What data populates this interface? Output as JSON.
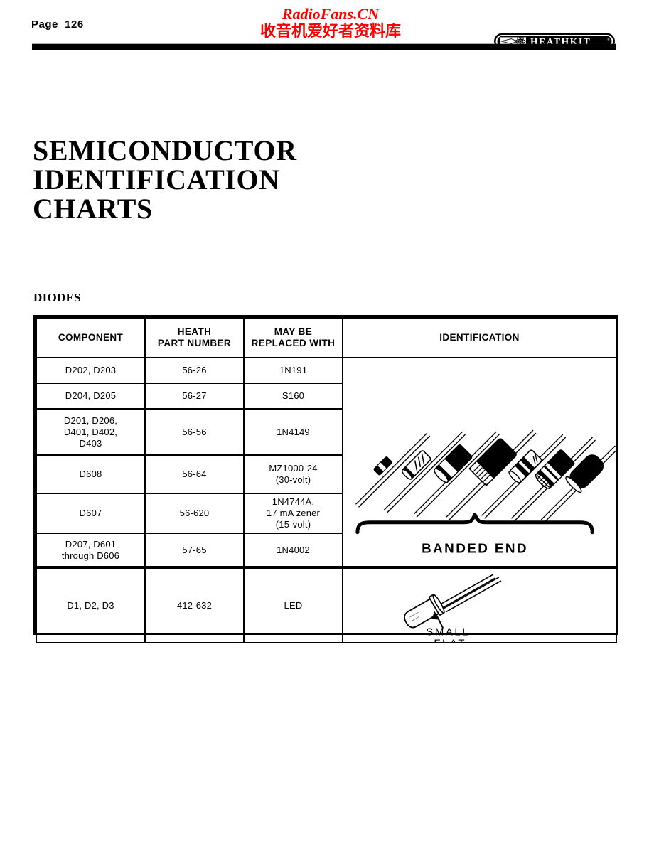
{
  "page": {
    "page_label": "Page  126",
    "brand_logo_text": "HEATHKIT",
    "watermark_latin": "RadioFans.CN",
    "watermark_cjk": "收音机爱好者资料库"
  },
  "title": {
    "line1": "SEMICONDUCTOR",
    "line2": "IDENTIFICATION",
    "line3": "CHARTS"
  },
  "section": {
    "label": "DIODES"
  },
  "table": {
    "headers": {
      "component": "COMPONENT",
      "part_number": "HEATH\nPART NUMBER",
      "replacement": "MAY BE\nREPLACED WITH",
      "identification": "IDENTIFICATION"
    },
    "rows": [
      {
        "component": "D202, D203",
        "part_number": "56-26",
        "replacement": "1N191"
      },
      {
        "component": "D204, D205",
        "part_number": "56-27",
        "replacement": "S160"
      },
      {
        "component": "D201, D206,\nD401, D402,\nD403",
        "part_number": "56-56",
        "replacement": "1N4149"
      },
      {
        "component": "D608",
        "part_number": "56-64",
        "replacement": "MZ1000-24\n(30-volt)"
      },
      {
        "component": "D607",
        "part_number": "56-620",
        "replacement": "1N4744A,\n17 mA zener\n(15-volt)"
      },
      {
        "component": "D207, D601\nthrough D606",
        "part_number": "57-65",
        "replacement": "1N4002"
      },
      {
        "component": "D1, D2, D3",
        "part_number": "412-632",
        "replacement": "LED"
      }
    ],
    "illustrations": {
      "diodes_caption": "BANDED END",
      "led_caption_line1": "SMALL",
      "led_caption_line2": "FLAT"
    }
  },
  "colors": {
    "ink": "#000000",
    "watermark_red": "#fb0000",
    "paper": "#ffffff"
  }
}
